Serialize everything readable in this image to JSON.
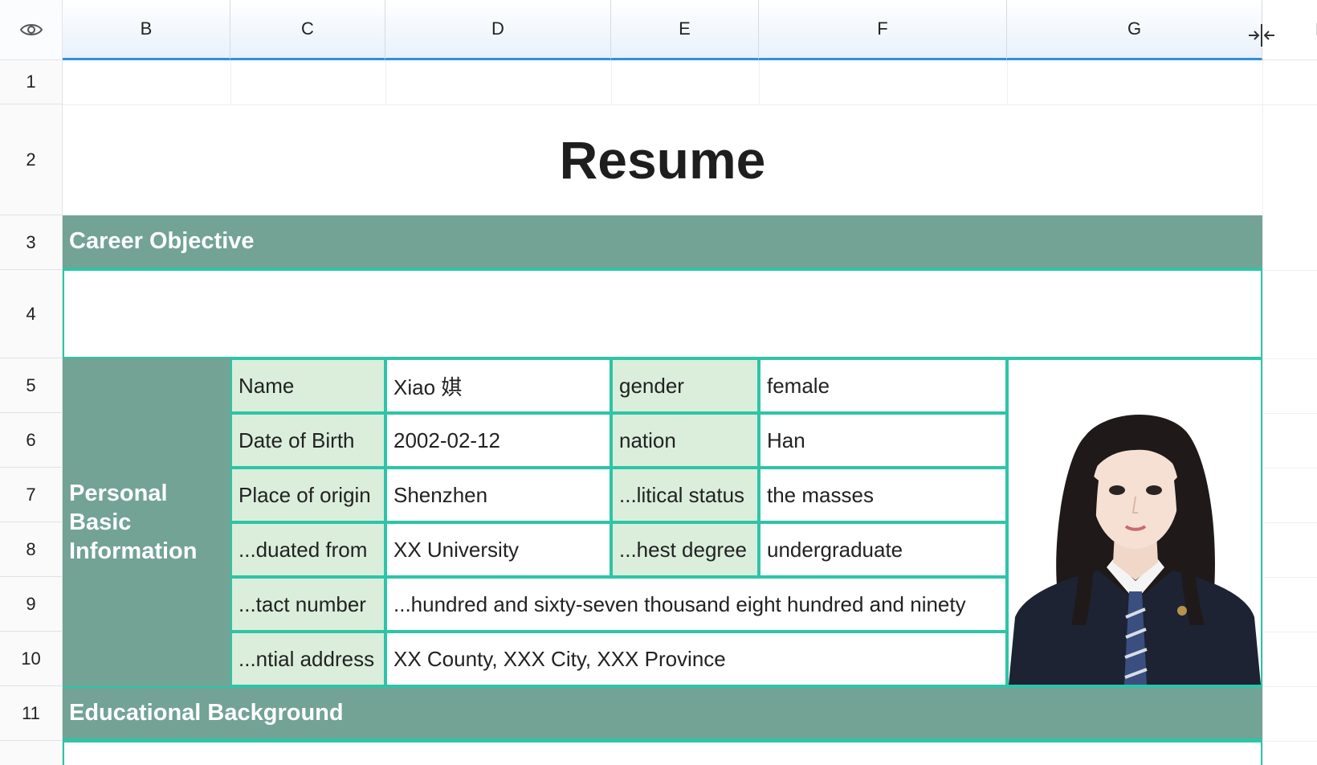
{
  "sheet": {
    "columns": [
      "B",
      "C",
      "D",
      "E",
      "F",
      "G",
      "H"
    ],
    "rows": [
      "1",
      "2",
      "3",
      "4",
      "5",
      "6",
      "7",
      "8",
      "9",
      "10",
      "11"
    ],
    "title": "Resume",
    "sections": {
      "career_objective": "Career Objective",
      "personal_info": "Personal Basic Information",
      "educational_background": "Educational Background"
    },
    "personal": {
      "name_label": "Name",
      "name_value": "Xiao 娸",
      "gender_label": "gender",
      "gender_value": "female",
      "dob_label": "Date of Birth",
      "dob_value": "2002-02-12",
      "nation_label": "nation",
      "nation_value": "Han",
      "origin_label": "Place of origin",
      "origin_value": "Shenzhen",
      "political_label": "...litical status",
      "political_value": "the masses",
      "graduated_label": "...duated from",
      "graduated_value": "XX University",
      "degree_label": "...hest degree",
      "degree_value": "undergraduate",
      "contact_label": "...tact number",
      "contact_value": "...hundred and sixty-seven thousand eight hundred and ninety",
      "address_label": "...ntial address",
      "address_value": "XX County, XXX City, XXX Province"
    }
  },
  "icons": {
    "corner": "eye-icon",
    "collapse": "collapse-columns-icon",
    "photo": "id-photo"
  },
  "colors": {
    "band": "#72a395",
    "label_fill": "#daeedb",
    "border": "#2ec4a7",
    "header_accent": "#2f8fe0"
  }
}
